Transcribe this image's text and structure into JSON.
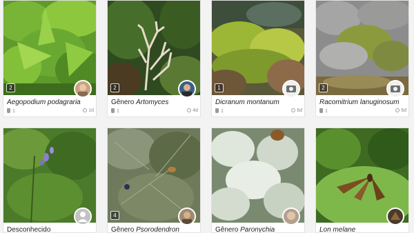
{
  "cards": [
    {
      "genus_prefix": "",
      "name": "Aegopodium podagraria",
      "obs_count": "1",
      "time": "1d",
      "badge": "2",
      "icon": "camera-icon"
    },
    {
      "genus_prefix": "Gênero ",
      "name": "Artomyces",
      "obs_count": "1",
      "time": "4d",
      "badge": "2",
      "icon": "camera-icon"
    },
    {
      "genus_prefix": "",
      "name": "Dicranum montanum",
      "obs_count": "1",
      "time": "6d",
      "badge": "1",
      "icon": "camera-icon"
    },
    {
      "genus_prefix": "",
      "name": "Racomitrium lanuginosum",
      "obs_count": "1",
      "time": "6d",
      "badge": "2",
      "icon": "camera-icon"
    },
    {
      "genus_prefix": "",
      "name": "Desconhecido",
      "obs_count": "",
      "time": "",
      "badge": "",
      "icon": "default-user-icon"
    },
    {
      "genus_prefix": "Gênero ",
      "name": "Psorodendron",
      "obs_count": "",
      "time": "",
      "badge": "4",
      "icon": "camera-icon"
    },
    {
      "genus_prefix": "Gênero ",
      "name": "Paronychia",
      "obs_count": "",
      "time": "",
      "badge": "",
      "icon": "camera-icon"
    },
    {
      "genus_prefix": "",
      "name": "Lon melane",
      "obs_count": "",
      "time": "",
      "badge": "",
      "icon": "camera-icon"
    }
  ]
}
